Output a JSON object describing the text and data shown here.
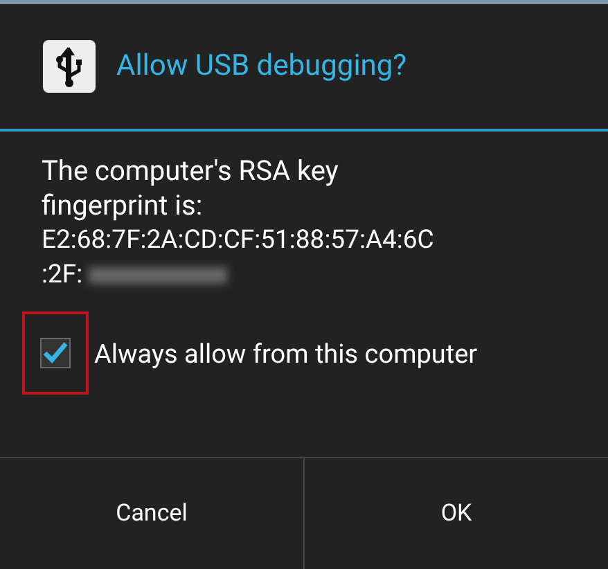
{
  "dialog": {
    "title": "Allow USB debugging?",
    "message": "The computer's RSA key fingerprint is:",
    "fingerprint_lines": [
      "E2:68:7F:2A:CD:CF:51:88:57:A4:6C",
      ":2F:"
    ],
    "fingerprint_redacted": true,
    "checkbox": {
      "label": "Always allow from this computer",
      "checked": true,
      "highlighted": true
    },
    "buttons": [
      "Cancel",
      "OK"
    ]
  }
}
